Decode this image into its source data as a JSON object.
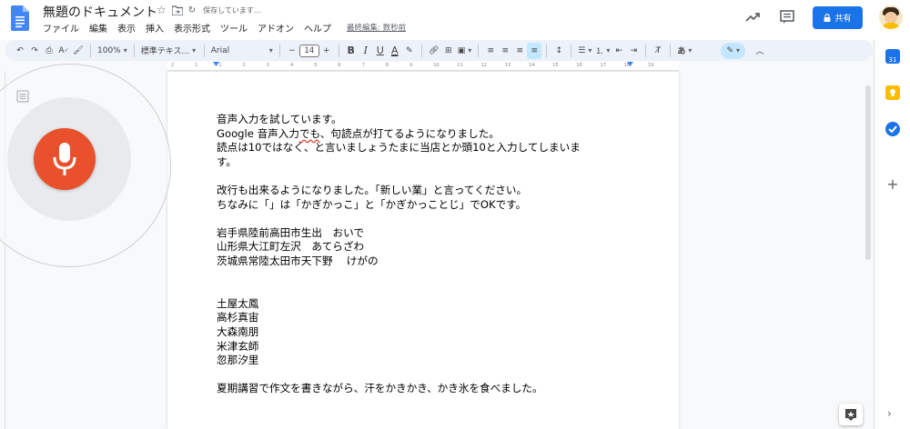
{
  "header": {
    "title": "無題のドキュメント",
    "saving_status": "保存しています...",
    "share_label": "共有",
    "last_edit": "最終編集: 数秒前"
  },
  "menu": [
    "ファイル",
    "編集",
    "表示",
    "挿入",
    "表示形式",
    "ツール",
    "アドオン",
    "ヘルプ"
  ],
  "toolbar": {
    "zoom": "100%",
    "style": "標準テキス...",
    "font": "Arial",
    "font_size": "14",
    "input_tools": "あ"
  },
  "ruler": [
    "2",
    "1",
    "1",
    "2",
    "3",
    "4",
    "5",
    "6",
    "7",
    "8",
    "9",
    "10",
    "11",
    "12",
    "13",
    "14",
    "15",
    "16",
    "17",
    "18",
    "19"
  ],
  "document": {
    "lines": [
      "音声入力を試しています。",
      "Google 音声入力でも、句読点が打てるようになりました。",
      "読点は10ではなく、と言いましょうたまに当店とか頭10と入力してしまいま",
      "す。",
      "",
      "改行も出来るようになりました。「新しい業」と言ってください。",
      "ちなみに「」は「かぎかっこ」と「かぎかっことじ」でOKです。",
      "",
      "岩手県陸前高田市生出　おいで",
      "山形県大江町左沢　あてらざわ",
      "茨城県常陸太田市天下野　 けがの",
      "",
      "",
      "土屋太鳳",
      "高杉真宙",
      "大森南朋",
      "米津玄師",
      "忽那汐里",
      "",
      "夏期講習で作文を書きながら、汗をかきかき、かき氷を食べました。"
    ]
  },
  "colors": {
    "share_button": "#1a73e8",
    "mic_button": "#e8512c",
    "toolbar_bg": "#edf2fa"
  }
}
